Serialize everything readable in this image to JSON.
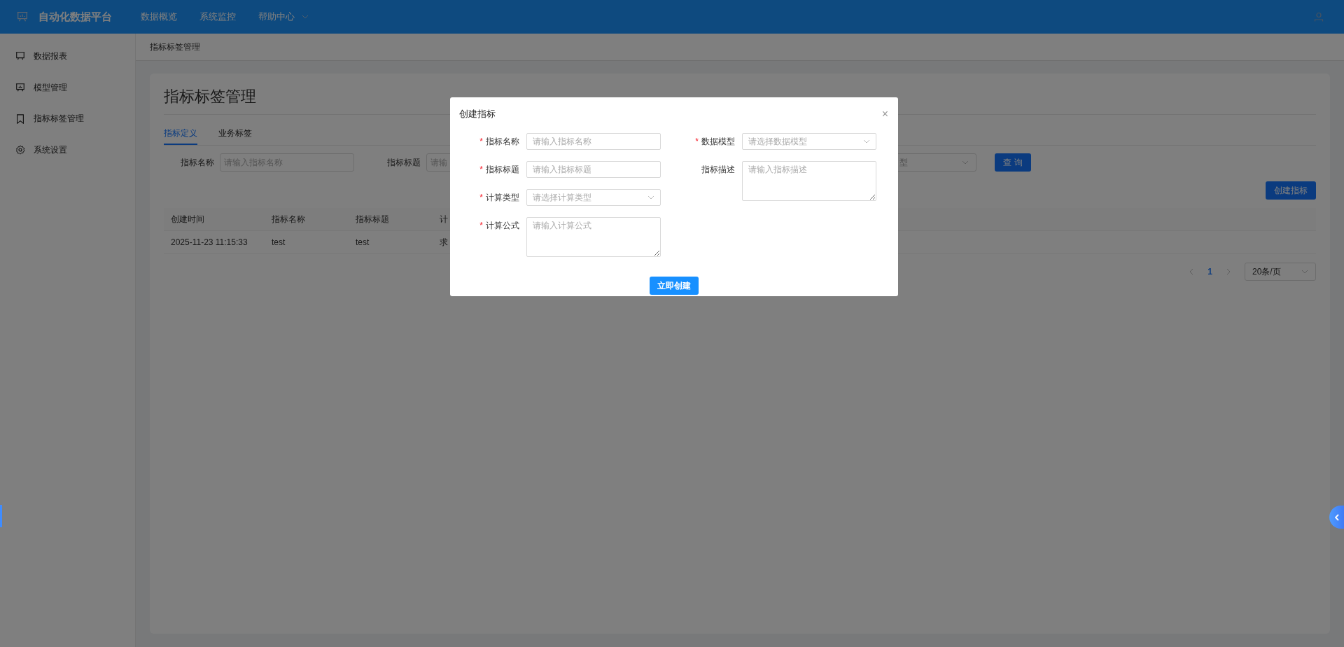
{
  "header": {
    "title": "自动化数据平台",
    "nav": [
      {
        "label": "数据概览",
        "dropdown": false
      },
      {
        "label": "系统监控",
        "dropdown": false
      },
      {
        "label": "帮助中心",
        "dropdown": true
      }
    ]
  },
  "sidebar": {
    "items": [
      {
        "label": "数据报表"
      },
      {
        "label": "模型管理"
      },
      {
        "label": "指标标签管理"
      },
      {
        "label": "系统设置"
      }
    ]
  },
  "breadcrumb": "指标标签管理",
  "page": {
    "title": "指标标签管理",
    "tabs": [
      {
        "label": "指标定义",
        "selected": true
      },
      {
        "label": "业务标签",
        "selected": false
      }
    ],
    "filters": [
      {
        "label": "指标名称",
        "placeholder": "请输入指标名称",
        "kind": "input"
      },
      {
        "label": "指标标题",
        "placeholder": "请输",
        "kind": "input"
      },
      {
        "placeholder": "型",
        "kind": "select"
      }
    ],
    "query_button": "查 询",
    "create_button": "创建指标",
    "table": {
      "columns": [
        "创建时间",
        "指标名称",
        "指标标题",
        "计"
      ],
      "rows": [
        [
          "2025-11-23 11:15:33",
          "test",
          "test",
          "求"
        ]
      ]
    },
    "pagination": {
      "pages": [
        {
          "label": "1",
          "selected": true
        }
      ],
      "page_size": "20条/页"
    }
  },
  "modal": {
    "title": "创建指标",
    "close": "×",
    "columns": [
      [
        {
          "label": "指标名称",
          "required_mark": "*",
          "kind": "input",
          "placeholder": "请输入指标名称"
        },
        {
          "label": "指标标题",
          "required_mark": "*",
          "kind": "input",
          "placeholder": "请输入指标标题"
        },
        {
          "label": "计算类型",
          "required_mark": "*",
          "kind": "select",
          "placeholder": "请选择计算类型"
        },
        {
          "label": "计算公式",
          "required_mark": "*",
          "kind": "textarea",
          "placeholder": "请输入计算公式"
        }
      ],
      [
        {
          "label": "数据模型",
          "required_mark": "*",
          "kind": "select",
          "placeholder": "请选择数据模型"
        },
        {
          "label": "指标描述",
          "kind": "textarea",
          "placeholder": "请输入指标描述"
        }
      ]
    ],
    "submit": "立即创建"
  }
}
